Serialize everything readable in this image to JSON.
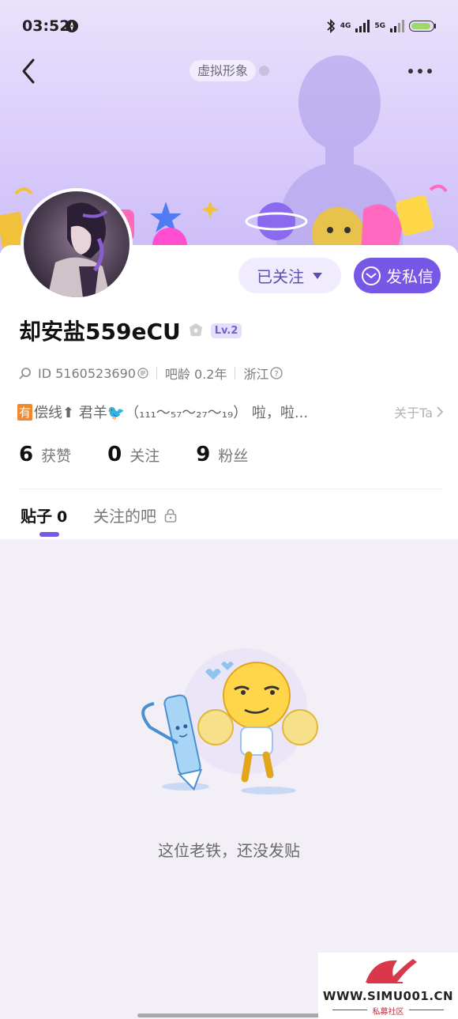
{
  "status_bar": {
    "time": "03:52",
    "network_1": "4G",
    "network_2": "5G"
  },
  "header": {
    "virtual_avatar_tag": "虚拟形象"
  },
  "profile": {
    "username": "却安盐559eCU",
    "level": "Lv.2",
    "id_text": "ID 5160523690",
    "tenure": "吧龄 0.2年",
    "location": "浙江",
    "bio_badge": "有",
    "bio": "偿线⬆ 君羊🐦（₁₁₁～₅₇～₂₇～₁₉） 啦，啦...",
    "about_link": "关于Ta",
    "follow_button": "已关注",
    "message_button": "发私信"
  },
  "stats": [
    {
      "value": "6",
      "label": "获赞"
    },
    {
      "value": "0",
      "label": "关注"
    },
    {
      "value": "9",
      "label": "粉丝"
    }
  ],
  "tabs": {
    "posts_label": "贴子",
    "posts_count": "0",
    "followed_bars_label": "关注的吧"
  },
  "empty_state": {
    "message": "这位老铁，还没发贴"
  },
  "watermark": {
    "domain": "WWW.SIMU001.CN",
    "sub": "私募社区"
  },
  "colors": {
    "accent": "#7757e6",
    "header_gradient_top": "#e9e2fb",
    "header_gradient_bottom": "#cdbdf8",
    "page_background": "#f3eff7"
  }
}
